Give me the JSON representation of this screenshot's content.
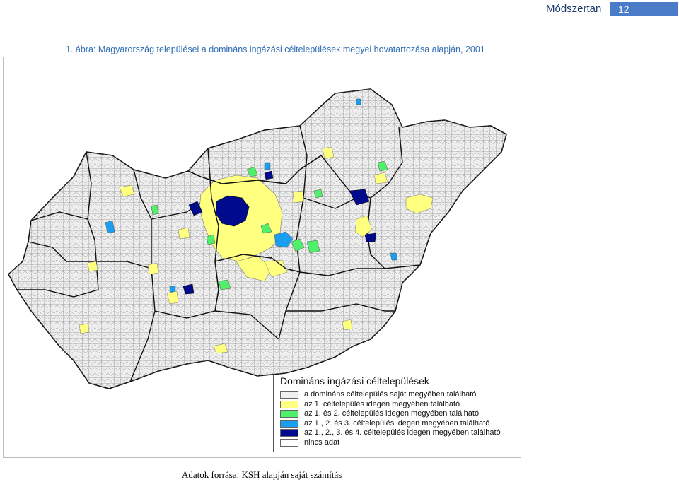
{
  "header": {
    "section": "Módszertan",
    "page_number": "12"
  },
  "figure": {
    "title": "1. ábra: Magyarország települései a domináns ingázási céltelepülések megyei hovatartozása alapján, 2001"
  },
  "legend": {
    "title": "Domináns ingázási céltelepülések",
    "items": [
      {
        "label": "a domináns céltelepülés saját megyében található",
        "color": "#f0f0f0"
      },
      {
        "label": "az 1. céltelepülés idegen megyében található",
        "color": "#ffff80"
      },
      {
        "label": "az 1. és 2. céltelepülés idegen megyében található",
        "color": "#4ff06a"
      },
      {
        "label": "az 1., 2. és 3. céltelepülés idegen megyében található",
        "color": "#1a9ff0"
      },
      {
        "label": "az 1., 2., 3. és 4. céltelepülés idegen megyében található",
        "color": "#000a8c"
      },
      {
        "label": "nincs adat",
        "color": "#ffffff"
      }
    ]
  },
  "source": "Adatok forrása: KSH alapján saját számítás"
}
